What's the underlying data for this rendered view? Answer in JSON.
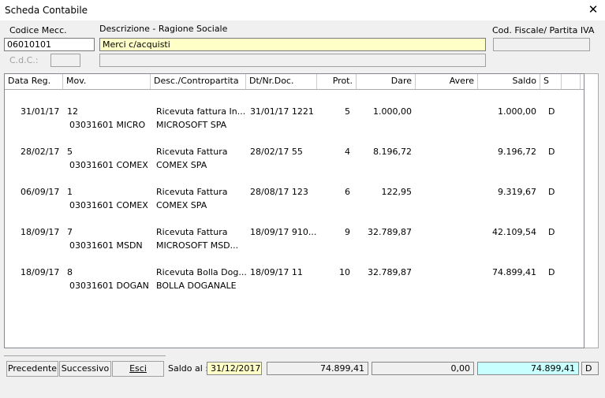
{
  "window": {
    "title": "Scheda Contabile",
    "close_glyph": "✕"
  },
  "labels": {
    "codice_mecc": "Codice Mecc.",
    "descrizione": "Descrizione - Ragione Sociale",
    "cod_fiscale": "Cod. Fiscale/ Partita IVA",
    "cdc": "C.d.C.:"
  },
  "fields": {
    "codice_mecc": "06010101",
    "descrizione": "Merci c/acquisti",
    "cod_fiscale": "",
    "cdc_code": "",
    "cdc_desc": ""
  },
  "table": {
    "headers": {
      "data_reg": "Data Reg.",
      "mov": "Mov.",
      "desc": "Desc./Contropartita",
      "doc": "Dt/Nr.Doc.",
      "prot": "Prot.",
      "dare": "Dare",
      "avere": "Avere",
      "saldo": "Saldo",
      "s": "S"
    },
    "rows": [
      {
        "data": "31/01/17",
        "mov": "12",
        "mov2": "03031601 MICRO",
        "desc": "Ricevuta fattura In...",
        "desc2": "MICROSOFT SPA",
        "doc": "31/01/17 1221",
        "prot": "5",
        "dare": "1.000,00",
        "avere": "",
        "saldo": "1.000,00",
        "s": "D"
      },
      {
        "data": "28/02/17",
        "mov": "5",
        "mov2": "03031601 COMEX",
        "desc": "Ricevuta Fattura",
        "desc2": "COMEX SPA",
        "doc": "28/02/17 55",
        "prot": "4",
        "dare": "8.196,72",
        "avere": "",
        "saldo": "9.196,72",
        "s": "D"
      },
      {
        "data": "06/09/17",
        "mov": "1",
        "mov2": "03031601 COMEX",
        "desc": "Ricevuta Fattura",
        "desc2": "COMEX SPA",
        "doc": "28/08/17 123",
        "prot": "6",
        "dare": "122,95",
        "avere": "",
        "saldo": "9.319,67",
        "s": "D"
      },
      {
        "data": "18/09/17",
        "mov": "7",
        "mov2": "03031601 MSDN",
        "desc": "Ricevuta Fattura",
        "desc2": "MICROSOFT MSD...",
        "doc": "18/09/17 910...",
        "prot": "9",
        "dare": "32.789,87",
        "avere": "",
        "saldo": "42.109,54",
        "s": "D"
      },
      {
        "data": "18/09/17",
        "mov": "8",
        "mov2": "03031601 DOGAN",
        "desc": "Ricevuta Bolla Dog...",
        "desc2": "BOLLA DOGANALE",
        "doc": "18/09/17 11",
        "prot": "10",
        "dare": "32.789,87",
        "avere": "",
        "saldo": "74.899,41",
        "s": "D"
      }
    ]
  },
  "buttons": {
    "precedente": "Precedente",
    "successivo": "Successivo",
    "esci": "Esci"
  },
  "footer": {
    "saldo_label": "Saldo al :",
    "saldo_date": "31/12/2017",
    "tot_dare": "74.899,41",
    "tot_avere": "0,00",
    "tot_saldo": "74.899,41",
    "tot_segno": "D"
  },
  "colors": {
    "yellow_field": "#ffffc8",
    "cyan_total": "#c8ffff"
  }
}
